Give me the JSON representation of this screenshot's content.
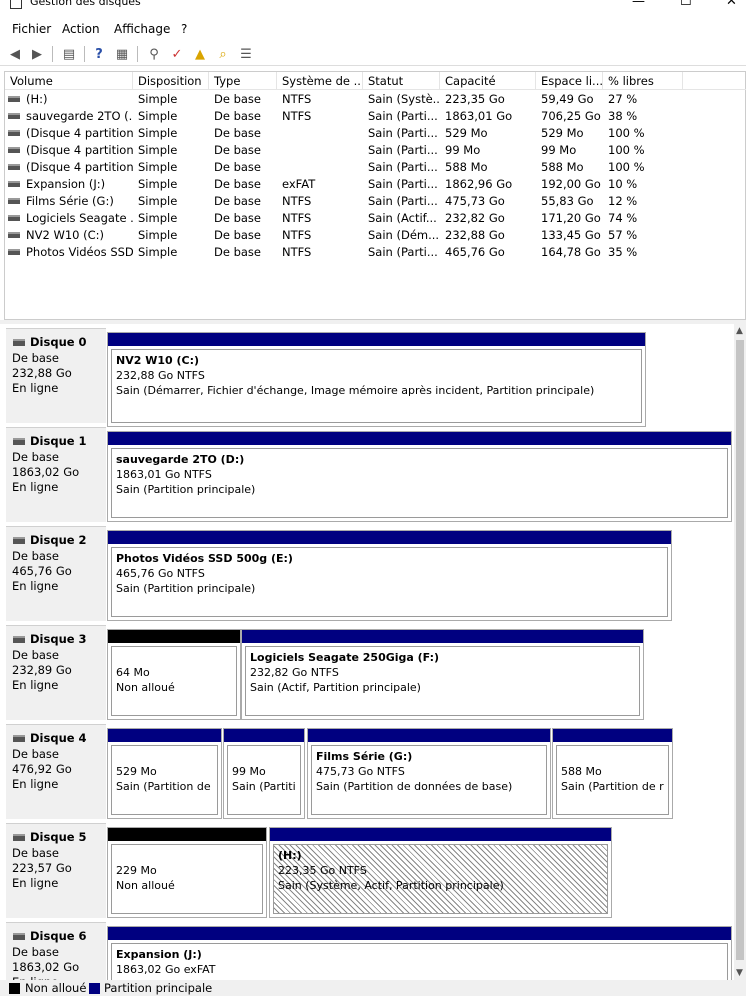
{
  "window": {
    "title": "Gestion des disques"
  },
  "menu": [
    "Fichier",
    "Action",
    "Affichage",
    "?"
  ],
  "toolbar": {
    "icons": [
      "back-arrow-icon",
      "forward-arrow-icon",
      "console-icon",
      "help-icon",
      "properties-icon",
      "connect-icon",
      "check-icon",
      "folder-up-icon",
      "search-folder-icon",
      "list-icon"
    ]
  },
  "volume_list": {
    "columns": [
      "Volume",
      "Disposition",
      "Type",
      "Système de ...",
      "Statut",
      "Capacité",
      "Espace li...",
      "% libres"
    ],
    "rows": [
      [
        "(H:)",
        "Simple",
        "De base",
        "NTFS",
        "Sain (Systè...",
        "223,35 Go",
        "59,49 Go",
        "27 %"
      ],
      [
        "sauvegarde 2TO (...",
        "Simple",
        "De base",
        "NTFS",
        "Sain (Parti...",
        "1863,01 Go",
        "706,25 Go",
        "38 %"
      ],
      [
        "(Disque 4 partition...",
        "Simple",
        "De base",
        "",
        "Sain (Parti...",
        "529 Mo",
        "529 Mo",
        "100 %"
      ],
      [
        "(Disque 4 partition...",
        "Simple",
        "De base",
        "",
        "Sain (Parti...",
        "99 Mo",
        "99 Mo",
        "100 %"
      ],
      [
        "(Disque 4 partition...",
        "Simple",
        "De base",
        "",
        "Sain (Parti...",
        "588 Mo",
        "588 Mo",
        "100 %"
      ],
      [
        "Expansion (J:)",
        "Simple",
        "De base",
        "exFAT",
        "Sain (Parti...",
        "1862,96 Go",
        "192,00 Go",
        "10 %"
      ],
      [
        "Films Série (G:)",
        "Simple",
        "De base",
        "NTFS",
        "Sain (Parti...",
        "475,73 Go",
        "55,83 Go",
        "12 %"
      ],
      [
        "Logiciels Seagate ...",
        "Simple",
        "De base",
        "NTFS",
        "Sain (Actif...",
        "232,82 Go",
        "171,20 Go",
        "74 %"
      ],
      [
        "NV2 W10 (C:)",
        "Simple",
        "De base",
        "NTFS",
        "Sain (Dém...",
        "232,88 Go",
        "133,45 Go",
        "57 %"
      ],
      [
        "Photos Vidéos SSD...",
        "Simple",
        "De base",
        "NTFS",
        "Sain (Parti...",
        "465,76 Go",
        "164,78 Go",
        "35 %"
      ]
    ]
  },
  "disks": [
    {
      "name": "Disque 0",
      "type": "De base",
      "size": "232,88 Go",
      "status": "En ligne",
      "partitions": [
        {
          "kind": "primary",
          "name": "NV2 W10  (C:)",
          "size": "232,88 Go NTFS",
          "status": "Sain (Démarrer, Fichier d'échange, Image mémoire après incident, Partition principale)"
        }
      ]
    },
    {
      "name": "Disque 1",
      "type": "De base",
      "size": "1863,02 Go",
      "status": "En ligne",
      "partitions": [
        {
          "kind": "primary",
          "name": "sauvegarde 2TO  (D:)",
          "size": "1863,01 Go NTFS",
          "status": "Sain (Partition principale)"
        }
      ]
    },
    {
      "name": "Disque 2",
      "type": "De base",
      "size": "465,76 Go",
      "status": "En ligne",
      "partitions": [
        {
          "kind": "primary",
          "name": "Photos Vidéos SSD 500g  (E:)",
          "size": "465,76 Go NTFS",
          "status": "Sain (Partition principale)"
        }
      ]
    },
    {
      "name": "Disque 3",
      "type": "De base",
      "size": "232,89 Go",
      "status": "En ligne",
      "partitions": [
        {
          "kind": "unallocated",
          "name": "",
          "size": "64 Mo",
          "status": "Non alloué"
        },
        {
          "kind": "primary",
          "name": "Logiciels Seagate 250Giga  (F:)",
          "size": "232,82 Go NTFS",
          "status": "Sain (Actif, Partition principale)"
        }
      ]
    },
    {
      "name": "Disque 4",
      "type": "De base",
      "size": "476,92 Go",
      "status": "En ligne",
      "partitions": [
        {
          "kind": "primary",
          "name": "",
          "size": "529 Mo",
          "status": "Sain (Partition de re"
        },
        {
          "kind": "primary",
          "name": "",
          "size": "99 Mo",
          "status": "Sain (Partitio"
        },
        {
          "kind": "primary",
          "name": "Films Série  (G:)",
          "size": "475,73 Go NTFS",
          "status": "Sain (Partition de données de base)"
        },
        {
          "kind": "primary",
          "name": "",
          "size": "588 Mo",
          "status": "Sain (Partition de ré"
        }
      ]
    },
    {
      "name": "Disque 5",
      "type": "De base",
      "size": "223,57 Go",
      "status": "En ligne",
      "partitions": [
        {
          "kind": "unallocated",
          "name": "",
          "size": "229 Mo",
          "status": "Non alloué"
        },
        {
          "kind": "primary-selected",
          "name": "(H:)",
          "size": "223,35 Go NTFS",
          "status": "Sain (Système, Actif, Partition principale)"
        }
      ]
    },
    {
      "name": "Disque 6",
      "type": "De base",
      "size": "1863,02 Go",
      "status": "En ligne",
      "partitions": [
        {
          "kind": "primary",
          "name": "Expansion  (J:)",
          "size": "1863,02 Go exFAT",
          "status": ""
        }
      ]
    }
  ],
  "legend": [
    {
      "label": "Non alloué",
      "color": "#000000"
    },
    {
      "label": "Partition principale",
      "color": "#000080"
    }
  ]
}
